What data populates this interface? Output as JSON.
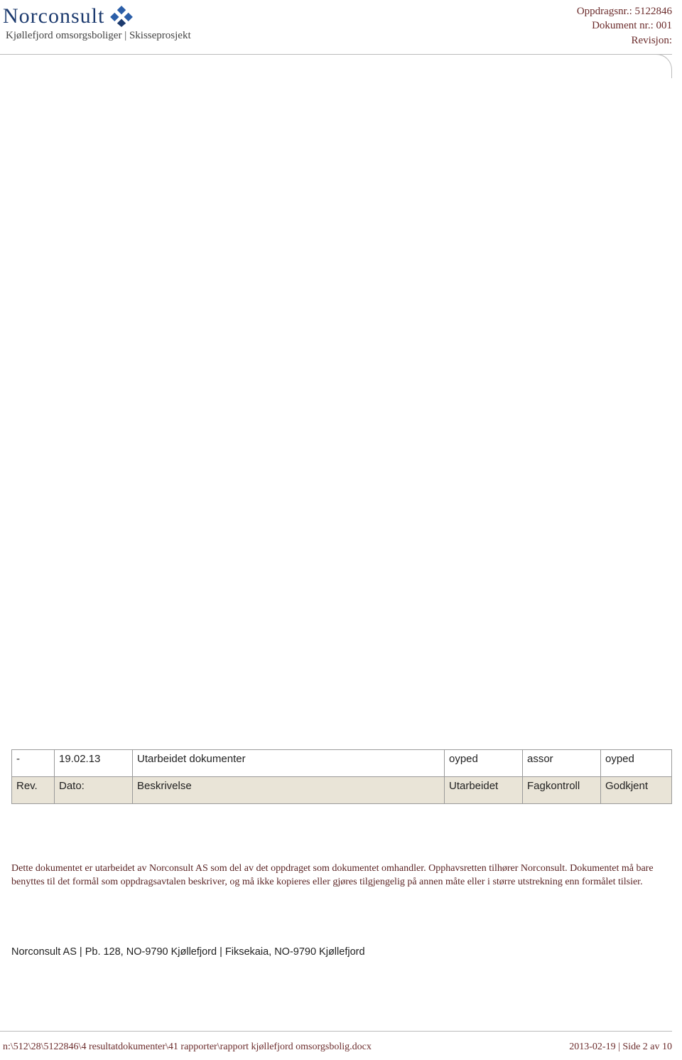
{
  "header": {
    "brand": "Norconsult",
    "subtitle": "Kjøllefjord omsorgsboliger | Skisseprosjekt",
    "meta": {
      "oppdrag_label": "Oppdragsnr.:",
      "oppdrag_value": "5122846",
      "dok_label": "Dokument nr.:",
      "dok_value": "001",
      "rev_label": "Revisjon:",
      "rev_value": ""
    }
  },
  "revision_table": {
    "data_row": {
      "rev": "-",
      "date": "19.02.13",
      "desc": "Utarbeidet dokumenter",
      "utarbeidet": "oyped",
      "fagkontroll": "assor",
      "godkjent": "oyped"
    },
    "header_row": {
      "rev": "Rev.",
      "date": "Dato:",
      "desc": "Beskrivelse",
      "utarbeidet": "Utarbeidet",
      "fagkontroll": "Fagkontroll",
      "godkjent": "Godkjent"
    }
  },
  "legal": {
    "p1": "Dette dokumentet er utarbeidet av Norconsult AS som del av det oppdraget som dokumentet omhandler. Opphavsretten tilhører Norconsult.",
    "p2": "Dokumentet må bare benyttes til det formål som oppdragsavtalen beskriver, og må ikke kopieres eller gjøres tilgjengelig på annen måte eller i større utstrekning enn formålet tilsier."
  },
  "byline": "Norconsult AS | Pb. 128, NO-9790 Kjøllefjord | Fiksekaia, NO-9790 Kjøllefjord",
  "footer": {
    "path": "n:\\512\\28\\5122846\\4 resultatdokumenter\\41 rapporter\\rapport kjøllefjord omsorgsbolig.docx",
    "page": "2013-02-19 | Side 2 av 10"
  }
}
